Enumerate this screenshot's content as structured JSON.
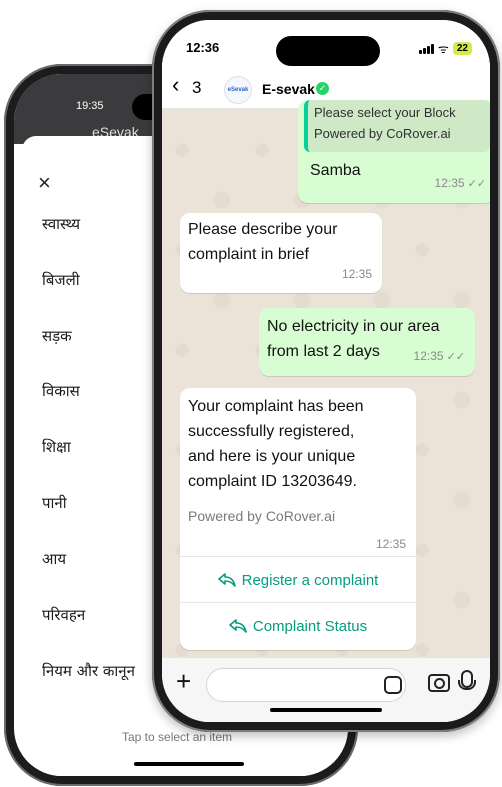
{
  "back_phone": {
    "status_time": "19:35",
    "header_title": "eSevak",
    "close_glyph": "×",
    "menu_items": [
      "स्वास्थ्य",
      "बिजली",
      "सड़क",
      "विकास",
      "शिक्षा",
      "पानी",
      "आय",
      "परिवहन",
      "नियम और कानून"
    ],
    "footer_text": "Tap to select an item"
  },
  "front_phone": {
    "status": {
      "time": "12:36",
      "battery": "22"
    },
    "header": {
      "back_count": "3",
      "contact_name": "E-sevak",
      "avatar_text": "eSevak"
    },
    "messages": {
      "quoted_line1": "Please select your Block",
      "quoted_line2": "Powered by CoRover.ai",
      "msg1_text": "Samba",
      "msg1_time": "12:35",
      "msg2_line1": "Please describe your",
      "msg2_line2": "complaint in brief",
      "msg2_time": "12:35",
      "msg3_line1": "No electricity in our area",
      "msg3_line2": "from last 2 days",
      "msg3_time": "12:35",
      "msg4_line1": "Your complaint has been",
      "msg4_line2": "successfully registered,",
      "msg4_line3": "and here is your unique",
      "msg4_line4": "complaint ID 13203649.",
      "msg4_powered": "Powered by CoRover.ai",
      "msg4_time": "12:35",
      "button1": "Register a complaint",
      "button2": "Complaint Status"
    },
    "colors": {
      "outgoing": "#d9fdd3",
      "incoming": "#ffffff",
      "accent": "#069b7e"
    }
  }
}
